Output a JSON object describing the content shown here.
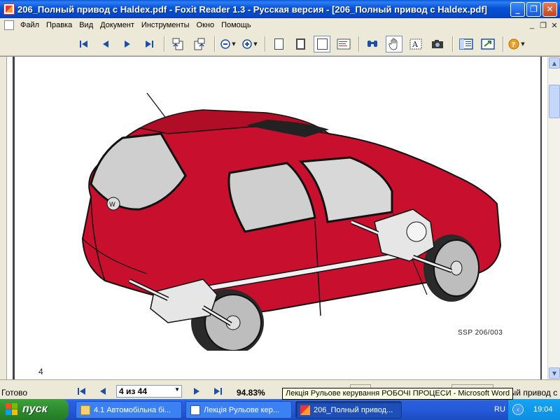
{
  "window": {
    "title": "206_Полный привод с Haldex.pdf - Foxit Reader 1.3 - Русская версия  - [206_Полный привод с Haldex.pdf]",
    "btn_minimize": "_",
    "btn_restore": "❐",
    "btn_close": "✕"
  },
  "menu": {
    "items": [
      "Файл",
      "Правка",
      "Вид",
      "Документ",
      "Инструменты",
      "Окно",
      "Помощь"
    ],
    "mdi_minimize": "_",
    "mdi_restore": "❐",
    "mdi_close": "✕"
  },
  "toolbar": {
    "icons": [
      "first-page-icon",
      "prev-page-icon",
      "next-page-icon",
      "last-page-icon",
      "rotate-left-icon",
      "rotate-right-icon",
      "zoom-out-icon",
      "zoom-in-icon",
      "actual-size-icon",
      "fit-page-icon",
      "fit-width-icon",
      "text-viewer-icon",
      "find-icon",
      "hand-tool-icon",
      "select-text-icon",
      "snapshot-icon",
      "bookmarks-icon",
      "thumbnails-icon",
      "help-icon"
    ]
  },
  "document": {
    "figure_caption": "SSP 206/003",
    "page_number": "4",
    "car_color": "#c8102e"
  },
  "statusbar": {
    "status": "Готово",
    "page_indicator": "4 из 44",
    "zoom": "94.83%",
    "tail_text": "Полный привод с Haldex"
  },
  "tooltip": {
    "text": "Лекція Рульове керування РОБОЧІ ПРОЦЕСИ - Microsoft Word"
  },
  "taskbar": {
    "start_label": "пуск",
    "tasks": [
      {
        "label": "4.1 Автомобільна бі..."
      },
      {
        "label": "Лекція Рульове кер..."
      },
      {
        "label": "206_Полный привод..."
      }
    ],
    "language": "RU",
    "clock": "19:04"
  }
}
